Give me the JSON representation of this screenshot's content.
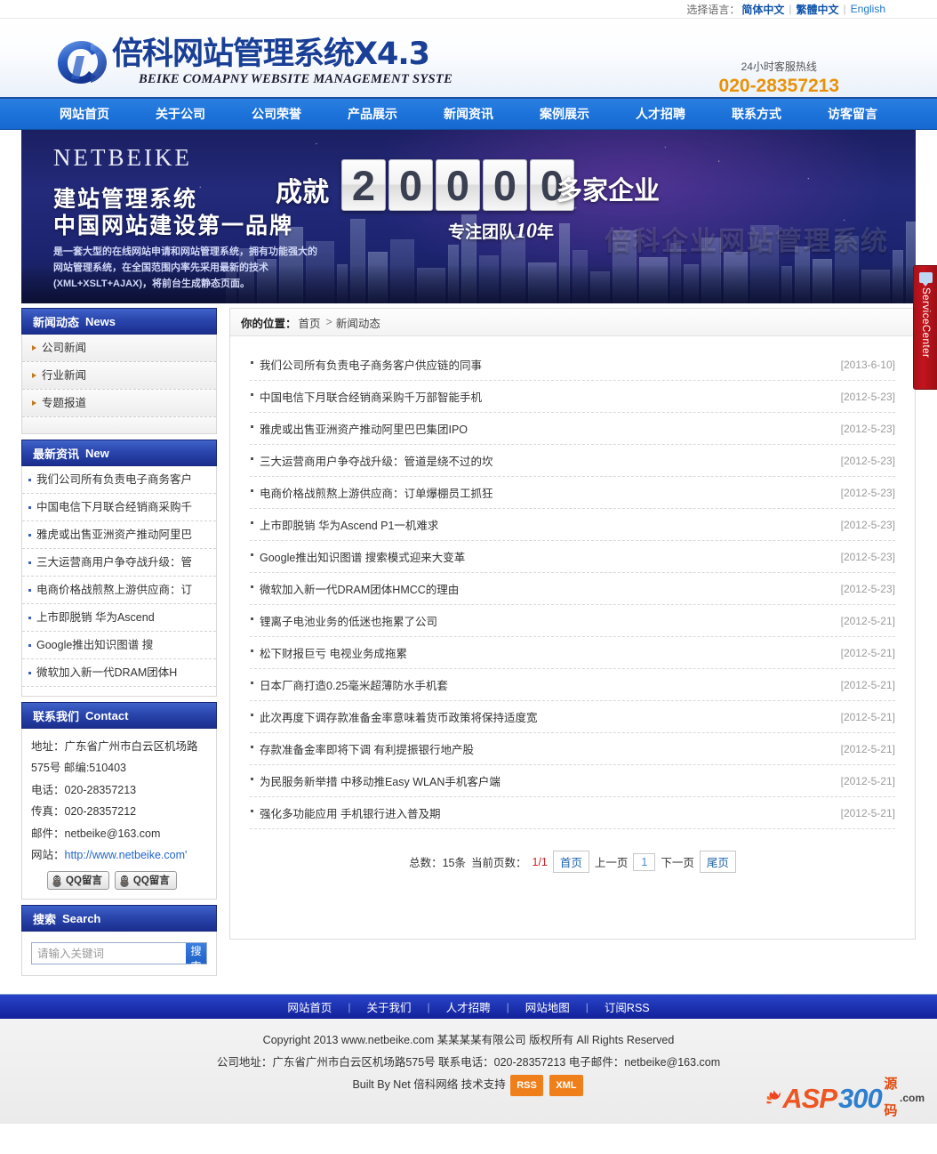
{
  "topbar": {
    "lang_label": "选择语言：",
    "langs": [
      {
        "label": "简体中文"
      },
      {
        "label": "繁體中文"
      },
      {
        "label": "English"
      }
    ]
  },
  "header": {
    "logo_cn": "倍科网站管理系统X4.3",
    "logo_en": "BEIKE COMAPNY WEBSITE MANAGEMENT SYSTE",
    "hotline_label": "24小时客服热线",
    "hotline_number": "020-28357213"
  },
  "mainnav": [
    {
      "label": "网站首页"
    },
    {
      "label": "关于公司"
    },
    {
      "label": "公司荣誉"
    },
    {
      "label": "产品展示"
    },
    {
      "label": "新闻资讯"
    },
    {
      "label": "案例展示"
    },
    {
      "label": "人才招聘"
    },
    {
      "label": "联系方式"
    },
    {
      "label": "访客留言"
    }
  ],
  "banner": {
    "brand": "NETBEIKE",
    "line1": "建站管理系统",
    "line2": "中国网站建设第一品牌",
    "desc": "是一套大型的在线网站申请和网站管理系统，拥有功能强大的网站管理系统，在全国范围内率先采用最新的技术(XML+XSLT+AJAX)，将前台生成静态页面。",
    "achieve": "成就",
    "digits": [
      "2",
      "0",
      "0",
      "0",
      "0"
    ],
    "suffix": "多家企业",
    "team_prefix": "专注团队",
    "team_years": "10",
    "team_suffix": "年",
    "ghost_text": "倍科企业网站管理系统"
  },
  "service_center": {
    "label": "ServiceCenter"
  },
  "sidebar": {
    "news_panel": {
      "title_cn": "新闻动态",
      "title_en": "News",
      "items": [
        {
          "label": "公司新闻"
        },
        {
          "label": "行业新闻"
        },
        {
          "label": "专题报道"
        }
      ]
    },
    "latest_panel": {
      "title_cn": "最新资讯",
      "title_en": "New",
      "items": [
        {
          "label": "我们公司所有负责电子商务客户"
        },
        {
          "label": "中国电信下月联合经销商采购千"
        },
        {
          "label": "雅虎或出售亚洲资产推动阿里巴"
        },
        {
          "label": "三大运营商用户争夺战升级：管"
        },
        {
          "label": "电商价格战煎熬上游供应商：订"
        },
        {
          "label": "上市即脱销 华为Ascend"
        },
        {
          "label": "Google推出知识图谱 搜"
        },
        {
          "label": "微软加入新一代DRAM团体H"
        }
      ]
    },
    "contact_panel": {
      "title_cn": "联系我们",
      "title_en": "Contact",
      "address": "地址：广东省广州市白云区机场路575号 邮编:510403",
      "phone": "电话：020-28357213",
      "fax": "传真：020-28357212",
      "email": "邮件：netbeike@163.com",
      "website_label": "网站：",
      "website": "http://www.netbeike.com'",
      "qq_buttons": [
        {
          "label": "QQ留言"
        },
        {
          "label": "QQ留言"
        }
      ]
    },
    "search_panel": {
      "title_cn": "搜索",
      "title_en": "Search",
      "placeholder": "请输入关键词",
      "value": "",
      "button_label": "搜索"
    }
  },
  "main": {
    "breadcrumb": {
      "label": "你的位置：",
      "home": "首页",
      "arrow": ">",
      "current": "新闻动态"
    },
    "news_list": [
      {
        "title": "我们公司所有负责电子商务客户供应链的同事",
        "date": "[2013-6-10]"
      },
      {
        "title": "中国电信下月联合经销商采购千万部智能手机",
        "date": "[2012-5-23]"
      },
      {
        "title": "雅虎或出售亚洲资产推动阿里巴巴集团IPO",
        "date": "[2012-5-23]"
      },
      {
        "title": "三大运营商用户争夺战升级：管道是绕不过的坎",
        "date": "[2012-5-23]"
      },
      {
        "title": "电商价格战煎熬上游供应商：订单爆棚员工抓狂",
        "date": "[2012-5-23]"
      },
      {
        "title": "上市即脱销 华为Ascend P1一机难求",
        "date": "[2012-5-23]"
      },
      {
        "title": "Google推出知识图谱 搜索模式迎来大变革",
        "date": "[2012-5-23]"
      },
      {
        "title": "微软加入新一代DRAM团体HMCC的理由",
        "date": "[2012-5-23]"
      },
      {
        "title": "锂离子电池业务的低迷也拖累了公司",
        "date": "[2012-5-21]"
      },
      {
        "title": "松下财报巨亏 电视业务成拖累",
        "date": "[2012-5-21]"
      },
      {
        "title": "日本厂商打造0.25毫米超薄防水手机套",
        "date": "[2012-5-21]"
      },
      {
        "title": "此次再度下调存款准备金率意味着货币政策将保持适度宽",
        "date": "[2012-5-21]"
      },
      {
        "title": "存款准备金率即将下调 有利提振银行地产股",
        "date": "[2012-5-21]"
      },
      {
        "title": "为民服务新举措 中移动推Easy WLAN手机客户端",
        "date": "[2012-5-21]"
      },
      {
        "title": "强化多功能应用 手机银行进入普及期",
        "date": "[2012-5-21]"
      }
    ],
    "pager": {
      "total_label": "总数：15条",
      "current_label": "当前页数：",
      "current_value": "1/1",
      "first": "首页",
      "prev": "上一页",
      "page_number": "1",
      "next": "下一页",
      "last": "尾页"
    }
  },
  "footer": {
    "nav": [
      {
        "label": "网站首页"
      },
      {
        "label": "关于我们"
      },
      {
        "label": "人才招聘"
      },
      {
        "label": "网站地图"
      },
      {
        "label": "订阅RSS"
      }
    ],
    "copyright": "Copyright 2013 www.netbeike.com 某某某某有限公司  版权所有  All Rights Reserved",
    "address_line": "公司地址：广东省广州市白云区机场路575号  联系电话：020-28357213 电子邮件：netbeike@163.com",
    "built_by": "Built By Net 倍科网络  技术支持",
    "rss_tag": "RSS",
    "xml_tag": "XML",
    "watermark": {
      "part1": "ASP",
      "part2": "300",
      "cn": "源码",
      "dotcom": ".com"
    }
  },
  "colors": {
    "nav_blue": "#1d73da",
    "panel_blue": "#2a46ad",
    "footer_blue": "#1e34b4",
    "accent_orange": "#e8920a",
    "link_blue": "#2266cc",
    "service_red": "#c3141c"
  }
}
